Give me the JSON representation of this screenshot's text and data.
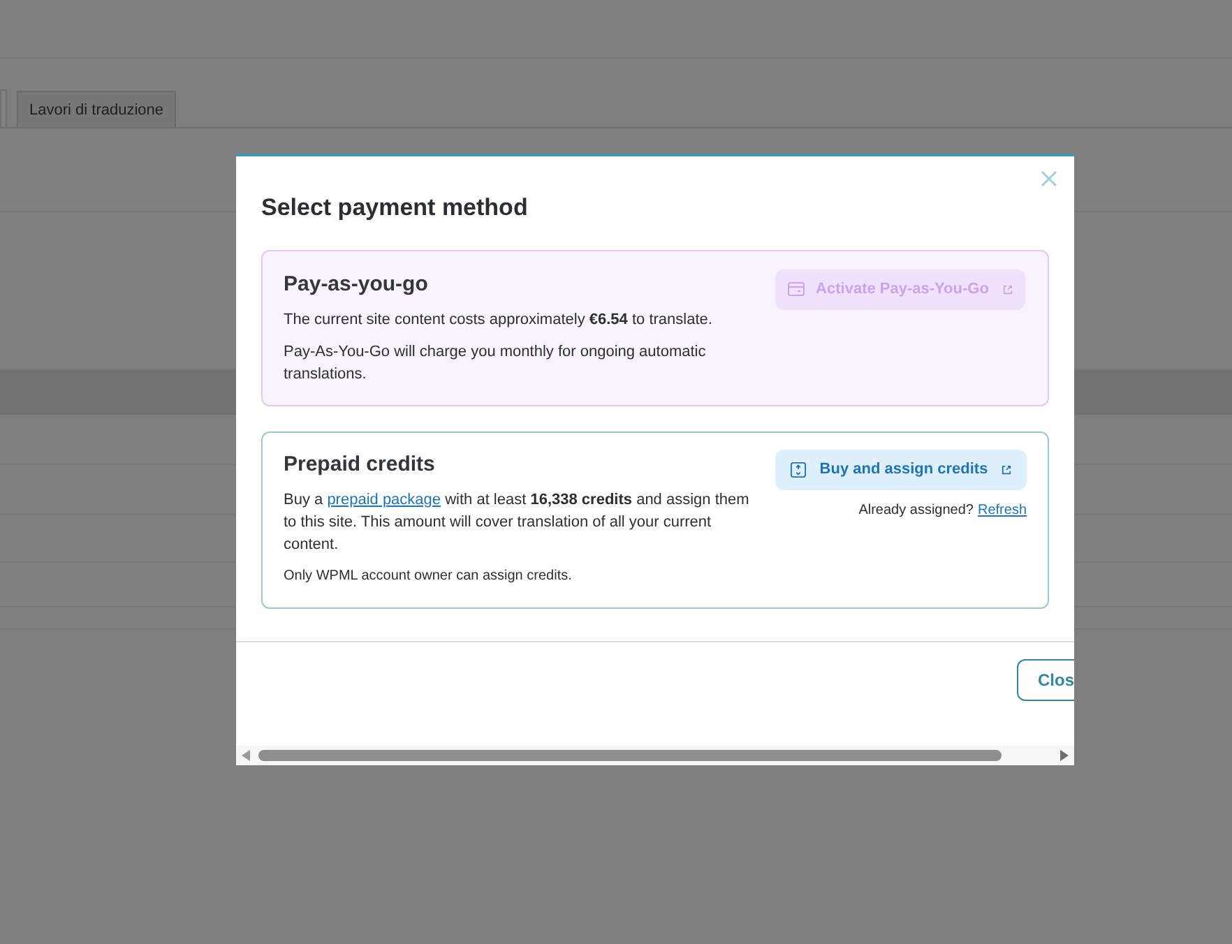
{
  "background_tabs": [
    {
      "label": "Lavori di traduzione",
      "selected": false
    }
  ],
  "dialog": {
    "title": "Select payment method",
    "options": [
      {
        "kind": "payg",
        "title": "Pay-as-you-go",
        "paragraphs": [
          "The current site content costs approximately **€6.54** to translate.",
          "Pay-As-You-Go will charge you monthly for ongoing automatic translations."
        ],
        "button": {
          "label": "Activate Pay-as-You-Go",
          "disabled": true
        }
      },
      {
        "kind": "prepaid",
        "title": "Prepaid credits",
        "text_before": "Buy a ",
        "link": "prepaid package",
        "text_after": " with at least **16,338 credits** and assign them to this site. This amount will cover translation of all your current content.",
        "note": "Only WPML account owner can assign credits.",
        "button": {
          "label": "Buy and assign credits",
          "disabled": false
        },
        "assigned_question": "Already assigned?",
        "refresh_link": "Refresh"
      }
    ],
    "close_button": "Clos"
  }
}
